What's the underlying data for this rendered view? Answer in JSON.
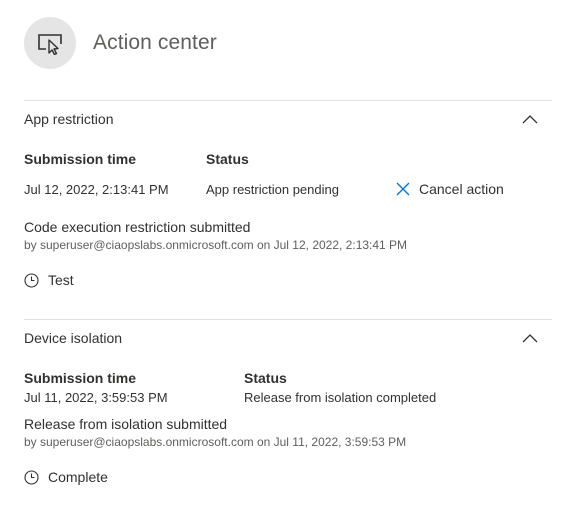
{
  "header": {
    "title": "Action center",
    "icon": "screen-pointer-icon"
  },
  "sections": [
    {
      "title": "App restriction",
      "submission_label": "Submission time",
      "status_label": "Status",
      "submission_time": "Jul 12, 2022, 2:13:41 PM",
      "status": "App restriction pending",
      "cancel_label": "Cancel action",
      "action_title": "Code execution restriction submitted",
      "byline": "by superuser@ciaopslabs.onmicrosoft.com on Jul 12, 2022, 2:13:41 PM",
      "comment": "Test"
    },
    {
      "title": "Device isolation",
      "submission_label": "Submission time",
      "status_label": "Status",
      "submission_time": "Jul 11, 2022, 3:59:53 PM",
      "status": "Release from isolation completed",
      "action_title": "Release from isolation submitted",
      "byline": "by superuser@ciaopslabs.onmicrosoft.com on Jul 11, 2022, 3:59:53 PM",
      "comment": "Complete"
    }
  ],
  "colors": {
    "text": "#323130",
    "secondary": "#605e5c",
    "accent": "#0078d4",
    "divider": "#e1dfdd",
    "icon_bg": "#e5e5e5"
  }
}
